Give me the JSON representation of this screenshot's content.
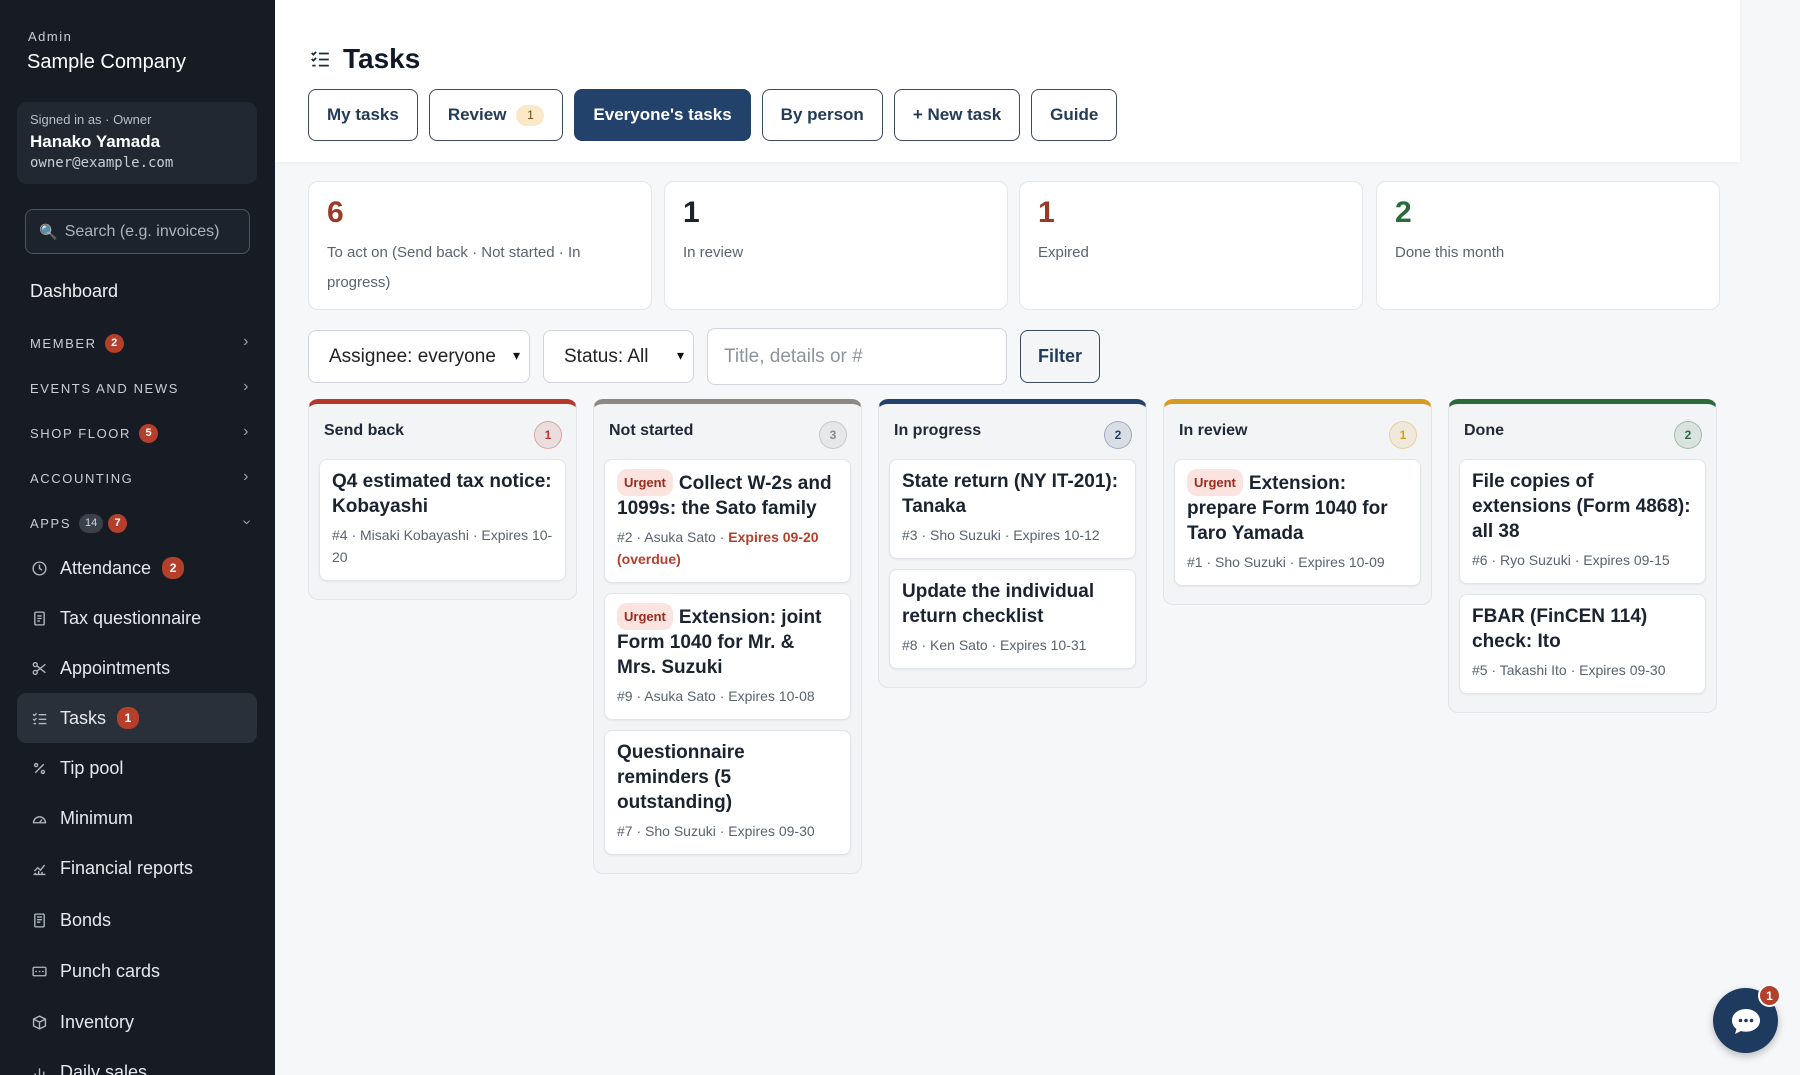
{
  "sidebar": {
    "admin_label": "Admin",
    "company": "Sample Company",
    "user": {
      "role": "Signed in as · Owner",
      "name": "Hanako Yamada",
      "email": "owner@example.com"
    },
    "search_placeholder": "Search (e.g. invoices)",
    "dashboard": "Dashboard",
    "sections": [
      {
        "label": "MEMBER",
        "badge": "2"
      },
      {
        "label": "EVENTS AND NEWS"
      },
      {
        "label": "SHOP FLOOR",
        "badge": "5"
      },
      {
        "label": "ACCOUNTING"
      },
      {
        "label": "APPS",
        "badge_gray": "14",
        "badge": "7"
      }
    ],
    "items": [
      {
        "label": "Attendance",
        "icon": "clock-icon",
        "badge": "2"
      },
      {
        "label": "Tax questionnaire",
        "icon": "document-icon"
      },
      {
        "label": "Appointments",
        "icon": "scissors-icon"
      },
      {
        "label": "Tasks",
        "icon": "tasks-icon",
        "badge": "1"
      },
      {
        "label": "Tip pool",
        "icon": "percent-icon"
      },
      {
        "label": "Minimum",
        "icon": "gauge-icon"
      },
      {
        "label": "Financial reports",
        "icon": "chart-icon"
      },
      {
        "label": "Bonds",
        "icon": "receipt-icon"
      },
      {
        "label": "Punch cards",
        "icon": "card-icon"
      },
      {
        "label": "Inventory",
        "icon": "box-icon"
      },
      {
        "label": "Daily sales",
        "icon": "bar-chart-icon"
      }
    ]
  },
  "header": {
    "title": "Tasks",
    "tabs": [
      {
        "label": "My tasks"
      },
      {
        "label": "Review",
        "count": "1"
      },
      {
        "label": "Everyone's tasks",
        "active": true
      },
      {
        "label": "By person"
      },
      {
        "label": "+ New task"
      },
      {
        "label": "Guide"
      }
    ]
  },
  "stats": [
    {
      "value": "6",
      "label": "To act on (Send back · Not started · In progress)",
      "color": "#9a3a26"
    },
    {
      "value": "1",
      "label": "In review",
      "color": "#1b2330"
    },
    {
      "value": "1",
      "label": "Expired",
      "color": "#9a3a26"
    },
    {
      "value": "2",
      "label": "Done this month",
      "color": "#2b6b3a"
    }
  ],
  "filters": {
    "assignee": "Assignee: everyone",
    "status": "Status: All",
    "search_placeholder": "Title, details or #",
    "button": "Filter"
  },
  "columns": [
    {
      "title": "Send back",
      "count": "1",
      "color": "#b5382a",
      "cards": [
        {
          "title": "Q4 estimated tax notice: Kobayashi",
          "meta": "#4 · Misaki Kobayashi · Expires 10-20"
        }
      ]
    },
    {
      "title": "Not started",
      "count": "3",
      "color": "#8c8883",
      "cards": [
        {
          "urgent": "Urgent",
          "title": "Collect W-2s and 1099s: the Sato family",
          "meta": "#2 · Asuka Sato · ",
          "overdue": "Expires 09-20 (overdue)"
        },
        {
          "urgent": "Urgent",
          "title": "Extension: joint Form 1040 for Mr. & Mrs. Suzuki",
          "meta": "#9 · Asuka Sato · Expires 10-08"
        },
        {
          "title": "Questionnaire reminders (5 outstanding)",
          "meta": "#7 · Sho Suzuki · Expires 09-30"
        }
      ]
    },
    {
      "title": "In progress",
      "count": "2",
      "color": "#23426b",
      "cards": [
        {
          "title": "State return (NY IT-201): Tanaka",
          "meta": "#3 · Sho Suzuki · Expires 10-12"
        },
        {
          "title": "Update the individual return checklist",
          "meta": "#8 · Ken Sato · Expires 10-31"
        }
      ]
    },
    {
      "title": "In review",
      "count": "1",
      "color": "#d89b21",
      "cards": [
        {
          "urgent": "Urgent",
          "title": "Extension: prepare Form 1040 for Taro Yamada",
          "meta": "#1 · Sho Suzuki · Expires 10-09"
        }
      ]
    },
    {
      "title": "Done",
      "count": "2",
      "color": "#2b6b3a",
      "cards": [
        {
          "title": "File copies of extensions (Form 4868): all 38",
          "meta": "#6 · Ryo Suzuki · Expires 09-15"
        },
        {
          "title": "FBAR (FinCEN 114) check: Ito",
          "meta": "#5 · Takashi Ito · Expires 09-30"
        }
      ]
    }
  ],
  "chat": {
    "badge": "1"
  }
}
